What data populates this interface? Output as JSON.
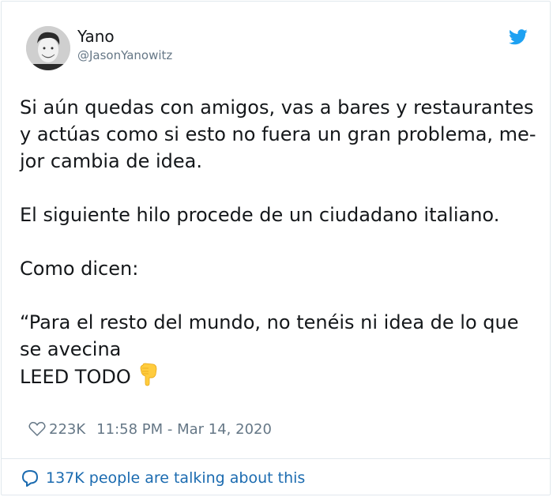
{
  "author": {
    "name": "Yano",
    "handle": "@JasonYanowitz",
    "avatar_icon": "profile-photo"
  },
  "brand": {
    "icon": "twitter-bird-icon",
    "color": "#1da1f2"
  },
  "tweet": {
    "lines": [
      "Si aún quedas con amigos, vas a bares y restaurantes",
      "y actúas como si esto no fuera un gran problema, me-",
      "jor cambia de idea.",
      "El siguiente hilo procede de un ciudadano italiano.",
      "Como dicen:",
      "“Para el resto del mundo, no tenéis ni idea de lo que",
      "se avecina",
      "LEED TODO"
    ],
    "emoji": "backhand-index-pointing-down"
  },
  "meta": {
    "likes": "223K",
    "time": "11:58 PM - Mar 14, 2020"
  },
  "footer": {
    "talking": "137K people are talking about this",
    "link_color": "#1b6bb0"
  }
}
